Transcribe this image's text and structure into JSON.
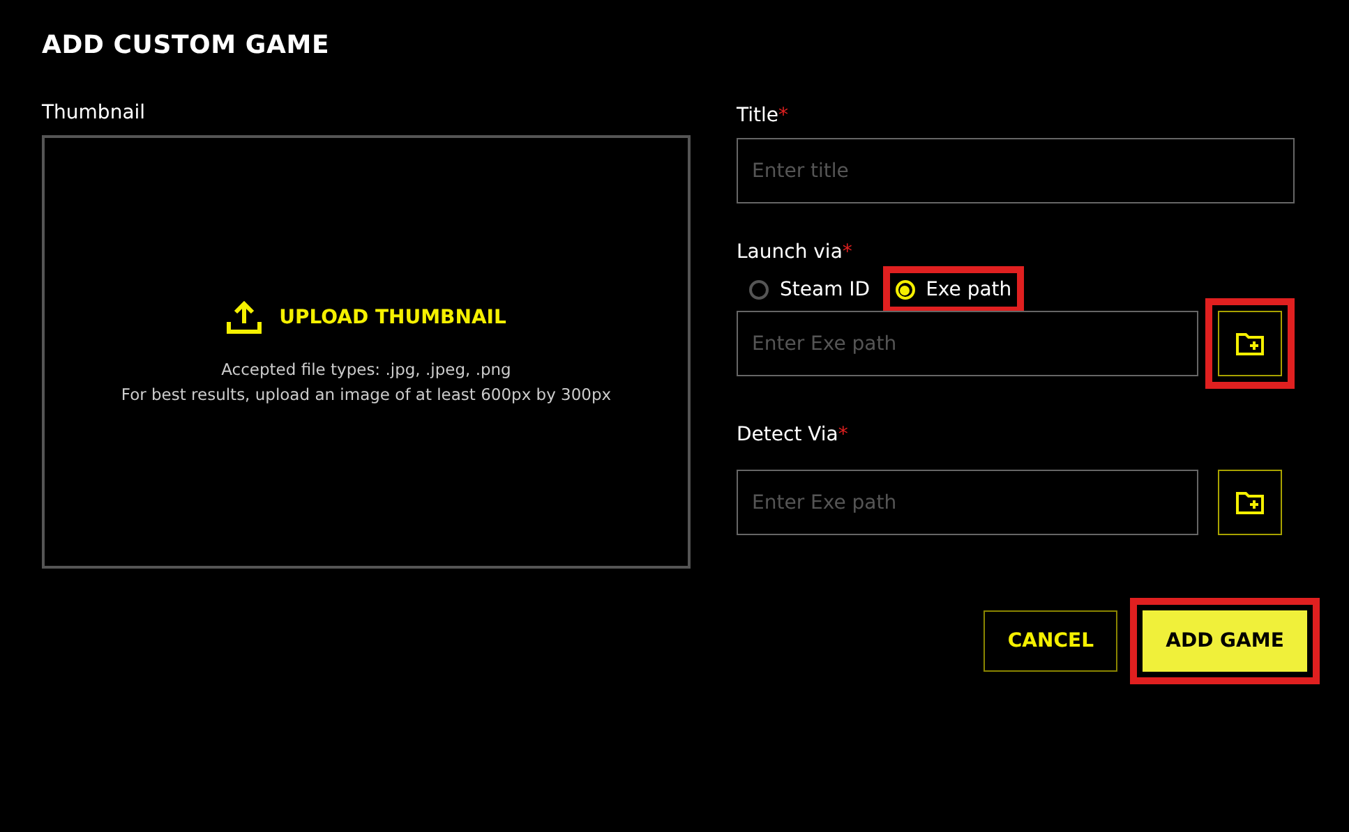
{
  "heading": "ADD CUSTOM GAME",
  "thumbnail": {
    "label": "Thumbnail",
    "upload": "UPLOAD THUMBNAIL",
    "hints": [
      "Accepted file types: .jpg, .jpeg, .png",
      "For best results, upload an image of at least 600px by 300px"
    ]
  },
  "title_field": {
    "label": "Title",
    "required_mark": "*",
    "placeholder": "Enter title"
  },
  "launch": {
    "label": "Launch via",
    "required_mark": "*",
    "options": [
      {
        "label": "Steam ID",
        "selected": false,
        "highlighted": false
      },
      {
        "label": "Exe path",
        "selected": true,
        "highlighted": true
      }
    ],
    "placeholder": "Enter Exe path",
    "browse_highlighted": true
  },
  "detect": {
    "label": "Detect Via",
    "required_mark": "*",
    "placeholder": "Enter Exe path",
    "browse_highlighted": false
  },
  "buttons": [
    {
      "label": "CANCEL",
      "kind": "secondary",
      "highlighted": false
    },
    {
      "label": "ADD GAME",
      "kind": "primary",
      "highlighted": true
    }
  ]
}
